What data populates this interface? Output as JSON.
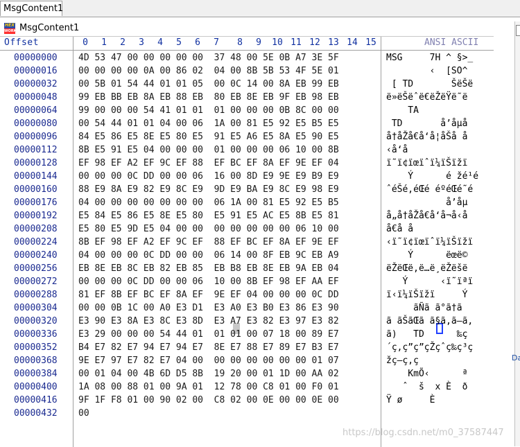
{
  "tabs": [
    {
      "label": "MsgContent1"
    }
  ],
  "window": {
    "title": "MsgContent1",
    "icon_label": "HEX",
    "icon_sublabel": "WORKS"
  },
  "header": {
    "offset_label": "Offset",
    "columns": [
      "0",
      "1",
      "2",
      "3",
      "4",
      "5",
      "6",
      "7",
      "8",
      "9",
      "10",
      "11",
      "12",
      "13",
      "14",
      "15"
    ],
    "ascii_label": "ANSI ASCII"
  },
  "rows": [
    {
      "offset": "00000000",
      "hex": "4D 53 47 00 00 00 00 00  37 48 00 5E 0B A7 3E 5F",
      "ascii": "MSG     7H ^ §>_"
    },
    {
      "offset": "00000016",
      "hex": "00 00 00 00 0A 00 86 02  04 00 8B 5B 53 4F 5E 01",
      "ascii": "        ‹  [SO^ "
    },
    {
      "offset": "00000032",
      "hex": "00 5B 01 54 44 01 01 05  00 0C 14 00 8A EB 99 EB",
      "ascii": " [ TD       ŠëŠë"
    },
    {
      "offset": "00000048",
      "hex": "99 EB BB EB 8A EB 88 EB  80 EB 8E EB 9F EB 98 EB",
      "ascii": "ë»ëŠëˆë€ëŽëŸë˜ë"
    },
    {
      "offset": "00000064",
      "hex": "99 00 00 00 54 41 01 01  01 00 00 00 0B 8C 00 00",
      "ascii": "    TA          "
    },
    {
      "offset": "00000080",
      "hex": "00 54 44 01 01 04 00 06  1A 00 81 E5 92 E5 B5 E5",
      "ascii": " TD       å’åµå"
    },
    {
      "offset": "00000096",
      "hex": "84 E5 86 E5 8E E5 80 E5  91 E5 A6 E5 8A E5 90 E5",
      "ascii": "å†åŽå€å‘å¦åŠå å"
    },
    {
      "offset": "00000112",
      "hex": "8B E5 91 E5 04 00 00 00  01 00 00 00 06 10 00 8B",
      "ascii": "‹å‘å              "
    },
    {
      "offset": "00000128",
      "hex": "EF 98 EF A2 EF 9C EF 88  EF BC EF 8A EF 9E EF 04",
      "ascii": "ï˜ï¢ïœïˆï¼ïŠïžï "
    },
    {
      "offset": "00000144",
      "hex": "00 00 00 0C DD 00 00 06  16 00 8D E9 9E E9 B9 E9",
      "ascii": "    Ý      é žé¹é"
    },
    {
      "offset": "00000160",
      "hex": "88 E9 8A E9 82 E9 8C E9  9D E9 BA E9 8C E9 98 E9",
      "ascii": "ˆéŠé‚éŒé éºéŒé˜é"
    },
    {
      "offset": "00000176",
      "hex": "04 00 00 00 00 00 00 00  06 1A 00 81 E5 92 E5 B5",
      "ascii": "           å’åµ"
    },
    {
      "offset": "00000192",
      "hex": "E5 84 E5 86 E5 8E E5 80  E5 91 E5 AC E5 8B E5 81",
      "ascii": "å„å†åŽå€å‘å¬å‹å"
    },
    {
      "offset": "00000208",
      "hex": "E5 80 E5 9D E5 04 00 00  00 00 00 00 00 06 10 00",
      "ascii": "å€å å          "
    },
    {
      "offset": "00000224",
      "hex": "8B EF 98 EF A2 EF 9C EF  88 EF BC EF 8A EF 9E EF",
      "ascii": "‹ï˜ï¢ïœïˆï¼ïŠïžï"
    },
    {
      "offset": "00000240",
      "hex": "04 00 00 00 0C DD 00 00  06 14 00 8F EB 9C EB A9",
      "ascii": "    Ý      ëœë©"
    },
    {
      "offset": "00000256",
      "hex": "EB 8E EB 8C EB 82 EB 85  EB B8 EB 8E EB 9A EB 04",
      "ascii": "ëŽëŒë‚ë…ë¸ëŽëšë "
    },
    {
      "offset": "00000272",
      "hex": "00 00 00 0C DD 00 00 06  10 00 8B EF 98 EF AA EF",
      "ascii": "   Ý      ‹ï˜ïªï"
    },
    {
      "offset": "00000288",
      "hex": "81 EF 8B EF BC EF 8A EF  9E EF 04 00 00 00 0C DD",
      "ascii": "ï‹ï¼ïŠïžï     Ý"
    },
    {
      "offset": "00000304",
      "hex": "00 00 0B 1C 00 A0 E3 D1  E3 A0 E3 B0 E3 86 E3 90",
      "ascii": "     ãÑã ã°ã†ã "
    },
    {
      "offset": "00000320",
      "hex": "E3 90 E3 8A E3 8C E3 8D  E3 A7 E3 82 E3 97 E3 82",
      "ascii": "ã ãŠãŒã ã§ã‚ã—ã‚"
    },
    {
      "offset": "00000336",
      "hex": "E3 29 00 00 00 54 44 01  01 01 00 07 18 00 89 E7",
      "ascii": "ã)   TD      ‰ç"
    },
    {
      "offset": "00000352",
      "hex": "B4 E7 82 E7 94 E7 94 E7  8E E7 88 E7 89 E7 B3 E7",
      "ascii": "´ç‚ç”ç”çŽçˆç‰ç³ç"
    },
    {
      "offset": "00000368",
      "hex": "9E E7 97 E7 82 E7 04 00  00 00 00 00 00 00 01 07",
      "ascii": "žç—ç‚ç          "
    },
    {
      "offset": "00000384",
      "hex": "00 01 04 00 4B 6D D5 8B  19 20 00 01 1D 00 AA 02",
      "ascii": "    KmÕ‹      ª "
    },
    {
      "offset": "00000400",
      "hex": "1A 08 00 88 01 00 9A 01  12 78 00 C8 01 00 F0 01",
      "ascii": "   ˆ  š  x È  ð "
    },
    {
      "offset": "00000416",
      "hex": "9F 1F F8 01 00 90 02 00  C8 02 00 0E 00 00 0E 00",
      "ascii": "Ÿ ø     È       "
    },
    {
      "offset": "00000432",
      "hex": "00",
      "ascii": ""
    }
  ],
  "watermark": "https://blog.csdn.net/m0_37587447",
  "side_label": "Da"
}
